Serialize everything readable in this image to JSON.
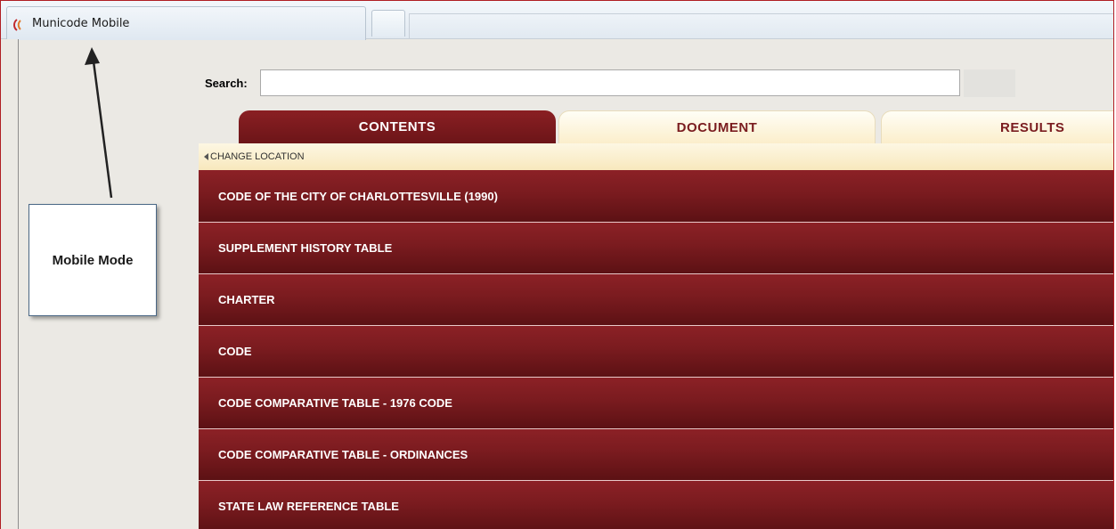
{
  "window": {
    "tab_title": "Municode Mobile",
    "logo_icon": "municode-logo-icon"
  },
  "annotation": {
    "callout_text": "Mobile Mode",
    "arrow_icon": "pointer-arrow-icon"
  },
  "search": {
    "label": "Search:",
    "value": "",
    "placeholder": ""
  },
  "tabs": [
    {
      "label": "CONTENTS",
      "active": true
    },
    {
      "label": "DOCUMENT",
      "active": false
    },
    {
      "label": "RESULTS",
      "active": false
    }
  ],
  "change_location": {
    "label": "CHANGE LOCATION"
  },
  "contents": {
    "items": [
      {
        "label": "CODE OF THE CITY OF CHARLOTTESVILLE (1990)"
      },
      {
        "label": "SUPPLEMENT HISTORY TABLE"
      },
      {
        "label": "CHARTER"
      },
      {
        "label": "CODE"
      },
      {
        "label": "CODE COMPARATIVE TABLE - 1976 CODE"
      },
      {
        "label": "CODE COMPARATIVE TABLE - ORDINANCES"
      },
      {
        "label": "STATE LAW REFERENCE TABLE"
      }
    ]
  },
  "colors": {
    "accent": "#7a1b1f",
    "tab_inactive": "#fbeecb",
    "frame_border": "#b01e23"
  }
}
